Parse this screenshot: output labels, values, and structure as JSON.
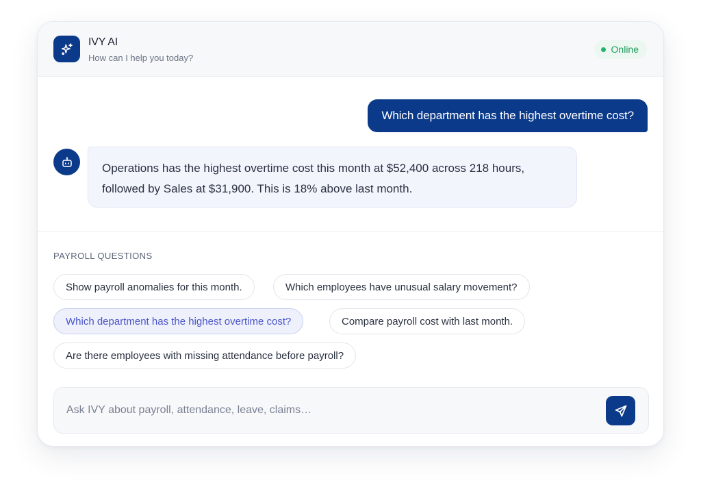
{
  "header": {
    "title": "IVY AI",
    "subtitle": "How can I help you today?",
    "status": "Online"
  },
  "conversation": {
    "user_message": "Which department has the highest overtime cost?",
    "bot_message": "Operations has the highest overtime cost this month at $52,400 across 218 hours, followed by Sales at $31,900. This is 18% above last month."
  },
  "suggestions": {
    "label": "PAYROLL QUESTIONS",
    "items": [
      "Show payroll anomalies for this month.",
      "Which employees have unusual salary movement?",
      "Which department has the highest overtime cost?",
      "Compare payroll cost with last month.",
      "Are there employees with missing attendance before payroll?"
    ],
    "active_index": 2
  },
  "composer": {
    "placeholder": "Ask IVY about payroll, attendance, leave, claims…",
    "value": ""
  },
  "icons": {
    "logo": "sparkles-icon",
    "bot_avatar": "bot-icon",
    "send": "send-icon"
  },
  "colors": {
    "brand": "#0b3a8a",
    "online": "#22b36b",
    "active_chip_text": "#4b55c9"
  }
}
